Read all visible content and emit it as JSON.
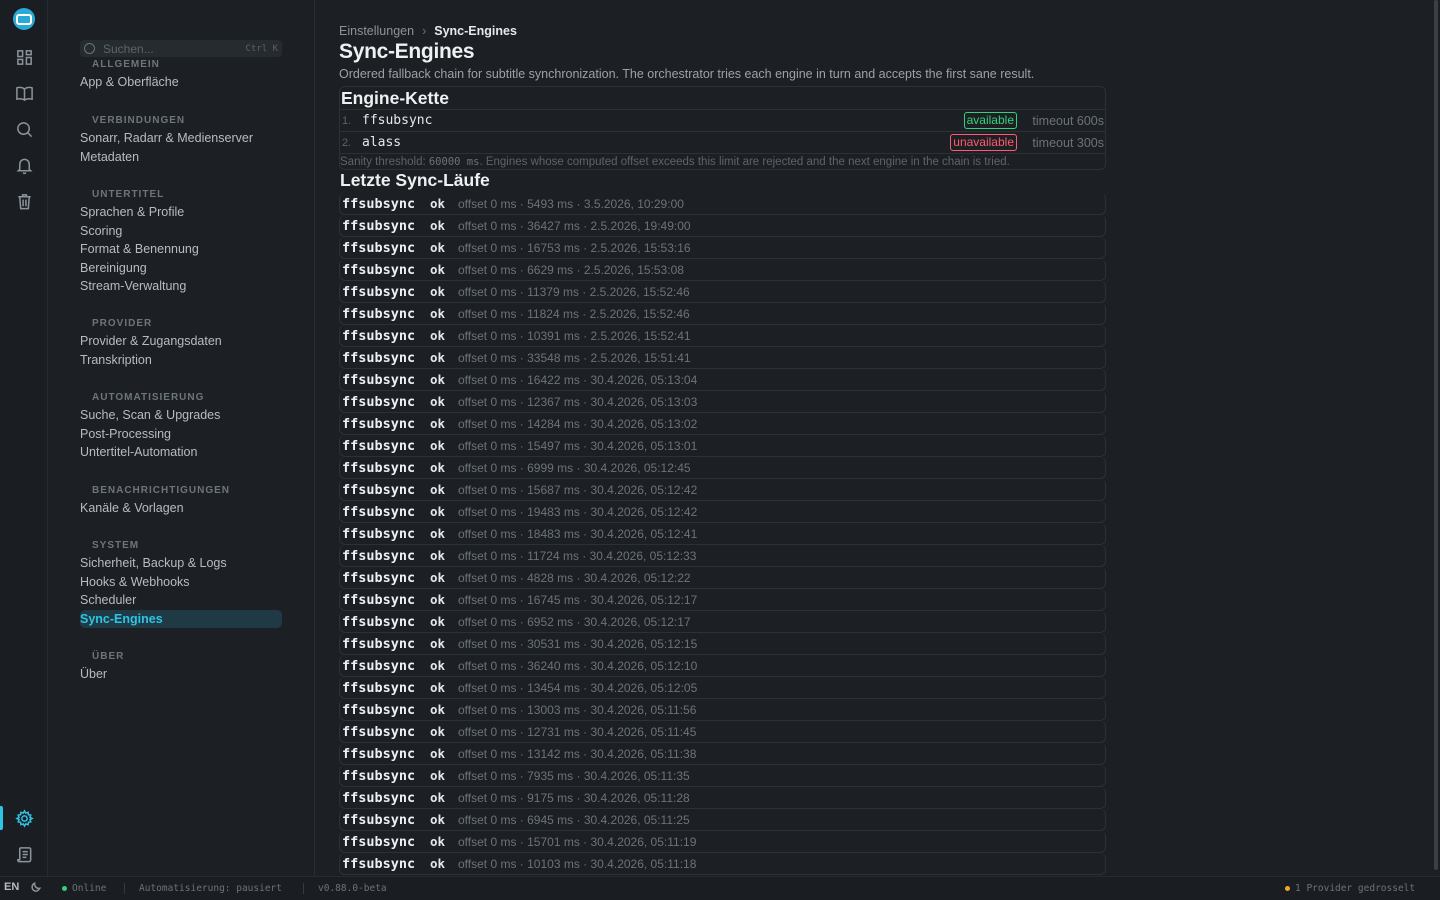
{
  "rail": {
    "logo_label": "logo",
    "items": [
      {
        "name": "dashboard-icon"
      },
      {
        "name": "library-icon"
      },
      {
        "name": "search-icon"
      },
      {
        "name": "bell-icon"
      },
      {
        "name": "trash-icon"
      },
      {
        "name": "gear-icon"
      },
      {
        "name": "logs-icon"
      }
    ]
  },
  "nav": {
    "search_placeholder": "Suchen...",
    "search_shortcut": "Ctrl K",
    "groups": [
      {
        "title": "ALLGEMEIN",
        "items": [
          "App & Oberfläche"
        ]
      },
      {
        "title": "VERBINDUNGEN",
        "items": [
          "Sonarr, Radarr & Medienserver",
          "Metadaten"
        ]
      },
      {
        "title": "UNTERTITEL",
        "items": [
          "Sprachen & Profile",
          "Scoring",
          "Format & Benennung",
          "Bereinigung",
          "Stream-Verwaltung"
        ]
      },
      {
        "title": "PROVIDER",
        "items": [
          "Provider & Zugangsdaten",
          "Transkription"
        ]
      },
      {
        "title": "AUTOMATISIERUNG",
        "items": [
          "Suche, Scan & Upgrades",
          "Post-Processing",
          "Untertitel-Automation"
        ]
      },
      {
        "title": "BENACHRICHTIGUNGEN",
        "items": [
          "Kanäle & Vorlagen"
        ]
      },
      {
        "title": "SYSTEM",
        "items": [
          "Sicherheit, Backup & Logs",
          "Hooks & Webhooks",
          "Scheduler",
          "Sync-Engines"
        ]
      },
      {
        "title": "ÜBER",
        "items": [
          "Über"
        ]
      }
    ],
    "active_item": "Sync-Engines"
  },
  "breadcrumb": {
    "parent": "Einstellungen",
    "separator": "›",
    "current": "Sync-Engines"
  },
  "page": {
    "title": "Sync-Engines",
    "description": "Ordered fallback chain for subtitle synchronization. The orchestrator tries each engine in turn and accepts the first sane result."
  },
  "engine_chain": {
    "title": "Engine-Kette",
    "engines": [
      {
        "index": "1.",
        "name": "ffsubsync",
        "status": "available",
        "timeout": "timeout 600s"
      },
      {
        "index": "2.",
        "name": "alass",
        "status": "unavailable",
        "timeout": "timeout 300s"
      }
    ],
    "sanity_prefix": "Sanity threshold: ",
    "sanity_value": "60000 ms",
    "sanity_suffix": ". Engines whose computed offset exceeds this limit are rejected and the next engine in the chain is tried.",
    "colors": {
      "available": "#34d17a",
      "unavailable": "#ff5a6e"
    }
  },
  "runs": {
    "title": "Letzte Sync-Läufe",
    "items": [
      {
        "engine": "ffsubsync",
        "status": "ok",
        "meta": "offset 0 ms · 5493 ms · 3.5.2026, 10:29:00"
      },
      {
        "engine": "ffsubsync",
        "status": "ok",
        "meta": "offset 0 ms · 36427 ms · 2.5.2026, 19:49:00"
      },
      {
        "engine": "ffsubsync",
        "status": "ok",
        "meta": "offset 0 ms · 16753 ms · 2.5.2026, 15:53:16"
      },
      {
        "engine": "ffsubsync",
        "status": "ok",
        "meta": "offset 0 ms · 6629 ms · 2.5.2026, 15:53:08"
      },
      {
        "engine": "ffsubsync",
        "status": "ok",
        "meta": "offset 0 ms · 11379 ms · 2.5.2026, 15:52:46"
      },
      {
        "engine": "ffsubsync",
        "status": "ok",
        "meta": "offset 0 ms · 11824 ms · 2.5.2026, 15:52:46"
      },
      {
        "engine": "ffsubsync",
        "status": "ok",
        "meta": "offset 0 ms · 10391 ms · 2.5.2026, 15:52:41"
      },
      {
        "engine": "ffsubsync",
        "status": "ok",
        "meta": "offset 0 ms · 33548 ms · 2.5.2026, 15:51:41"
      },
      {
        "engine": "ffsubsync",
        "status": "ok",
        "meta": "offset 0 ms · 16422 ms · 30.4.2026, 05:13:04"
      },
      {
        "engine": "ffsubsync",
        "status": "ok",
        "meta": "offset 0 ms · 12367 ms · 30.4.2026, 05:13:03"
      },
      {
        "engine": "ffsubsync",
        "status": "ok",
        "meta": "offset 0 ms · 14284 ms · 30.4.2026, 05:13:02"
      },
      {
        "engine": "ffsubsync",
        "status": "ok",
        "meta": "offset 0 ms · 15497 ms · 30.4.2026, 05:13:01"
      },
      {
        "engine": "ffsubsync",
        "status": "ok",
        "meta": "offset 0 ms · 6999 ms · 30.4.2026, 05:12:45"
      },
      {
        "engine": "ffsubsync",
        "status": "ok",
        "meta": "offset 0 ms · 15687 ms · 30.4.2026, 05:12:42"
      },
      {
        "engine": "ffsubsync",
        "status": "ok",
        "meta": "offset 0 ms · 19483 ms · 30.4.2026, 05:12:42"
      },
      {
        "engine": "ffsubsync",
        "status": "ok",
        "meta": "offset 0 ms · 18483 ms · 30.4.2026, 05:12:41"
      },
      {
        "engine": "ffsubsync",
        "status": "ok",
        "meta": "offset 0 ms · 11724 ms · 30.4.2026, 05:12:33"
      },
      {
        "engine": "ffsubsync",
        "status": "ok",
        "meta": "offset 0 ms · 4828 ms · 30.4.2026, 05:12:22"
      },
      {
        "engine": "ffsubsync",
        "status": "ok",
        "meta": "offset 0 ms · 16745 ms · 30.4.2026, 05:12:17"
      },
      {
        "engine": "ffsubsync",
        "status": "ok",
        "meta": "offset 0 ms · 6952 ms · 30.4.2026, 05:12:17"
      },
      {
        "engine": "ffsubsync",
        "status": "ok",
        "meta": "offset 0 ms · 30531 ms · 30.4.2026, 05:12:15"
      },
      {
        "engine": "ffsubsync",
        "status": "ok",
        "meta": "offset 0 ms · 36240 ms · 30.4.2026, 05:12:10"
      },
      {
        "engine": "ffsubsync",
        "status": "ok",
        "meta": "offset 0 ms · 13454 ms · 30.4.2026, 05:12:05"
      },
      {
        "engine": "ffsubsync",
        "status": "ok",
        "meta": "offset 0 ms · 13003 ms · 30.4.2026, 05:11:56"
      },
      {
        "engine": "ffsubsync",
        "status": "ok",
        "meta": "offset 0 ms · 12731 ms · 30.4.2026, 05:11:45"
      },
      {
        "engine": "ffsubsync",
        "status": "ok",
        "meta": "offset 0 ms · 13142 ms · 30.4.2026, 05:11:38"
      },
      {
        "engine": "ffsubsync",
        "status": "ok",
        "meta": "offset 0 ms · 7935 ms · 30.4.2026, 05:11:35"
      },
      {
        "engine": "ffsubsync",
        "status": "ok",
        "meta": "offset 0 ms · 9175 ms · 30.4.2026, 05:11:28"
      },
      {
        "engine": "ffsubsync",
        "status": "ok",
        "meta": "offset 0 ms · 6945 ms · 30.4.2026, 05:11:25"
      },
      {
        "engine": "ffsubsync",
        "status": "ok",
        "meta": "offset 0 ms · 15701 ms · 30.4.2026, 05:11:19"
      },
      {
        "engine": "ffsubsync",
        "status": "ok",
        "meta": "offset 0 ms · 10103 ms · 30.4.2026, 05:11:18"
      }
    ]
  },
  "statusbar": {
    "lang": "EN",
    "online": "Online",
    "automation": "Automatisierung: pausiert",
    "version": "v0.88.0-beta",
    "providers": "1 Provider gedrosselt",
    "colors": {
      "online": "#34d17a",
      "warning": "#f5a623"
    }
  }
}
